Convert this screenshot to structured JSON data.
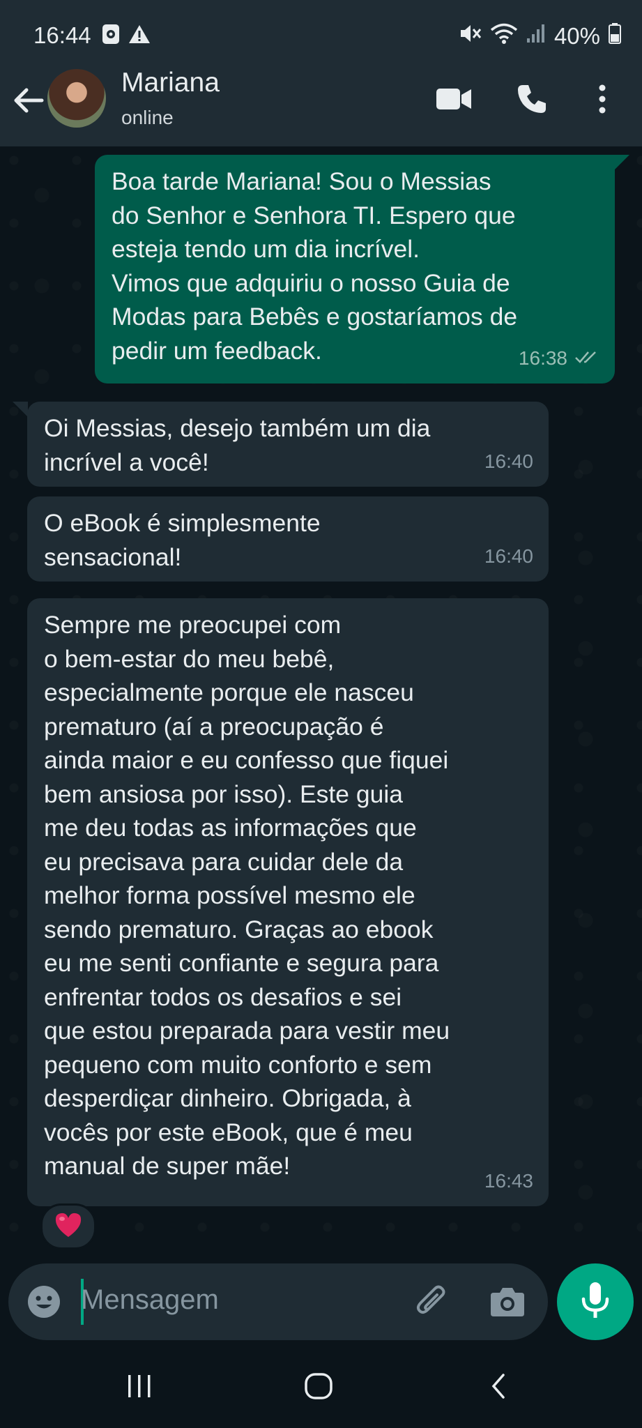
{
  "status_bar": {
    "time": "16:44",
    "battery": "40%"
  },
  "header": {
    "contact_name": "Mariana",
    "presence": "online"
  },
  "messages": [
    {
      "direction": "outgoing",
      "lines": [
        "Boa tarde Mariana! Sou o Messias",
        "do Senhor e Senhora TI. Espero que",
        "esteja tendo um dia incrível.",
        "Vimos que adquiriu o nosso Guia de",
        "Modas para Bebês e gostaríamos de",
        "pedir um feedback."
      ],
      "time": "16:38",
      "status": "read"
    },
    {
      "direction": "incoming",
      "lines": [
        "Oi Messias, desejo também um dia",
        "incrível a você!"
      ],
      "time": "16:40"
    },
    {
      "direction": "incoming",
      "lines": [
        "O eBook é simplesmente",
        "sensacional!"
      ],
      "time": "16:40"
    },
    {
      "direction": "incoming",
      "lines": [
        "Sempre me preocupei com",
        "o bem-estar do meu bebê,",
        "especialmente porque ele nasceu",
        "prematuro (aí a preocupação é",
        "ainda maior e eu confesso que fiquei",
        "bem ansiosa por isso). Este guia",
        "me deu todas as informações que",
        "eu precisava para cuidar dele da",
        "melhor forma possível mesmo ele",
        "sendo prematuro. Graças ao ebook",
        "eu me senti confiante e segura para",
        "enfrentar todos os desafios e sei",
        "que estou preparada para vestir meu",
        "pequeno com muito conforto e sem",
        "desperdiçar dinheiro. Obrigada, à",
        "vocês por este eBook, que é meu",
        "manual de super mãe!"
      ],
      "time": "16:43",
      "reaction": "❤️"
    }
  ],
  "composer": {
    "placeholder": "Mensagem"
  },
  "colors": {
    "outgoing_bubble": "#005c4b",
    "incoming_bubble": "#1f2c34",
    "accent": "#00a884",
    "read_ticks": "#9bbeb5"
  },
  "icons": {
    "back": "arrow-left-icon",
    "video_call": "video-camera-icon",
    "voice_call": "phone-icon",
    "menu": "more-vertical-icon",
    "emoji": "emoji-icon",
    "attach": "paperclip-icon",
    "camera": "camera-icon",
    "mic": "microphone-icon"
  }
}
